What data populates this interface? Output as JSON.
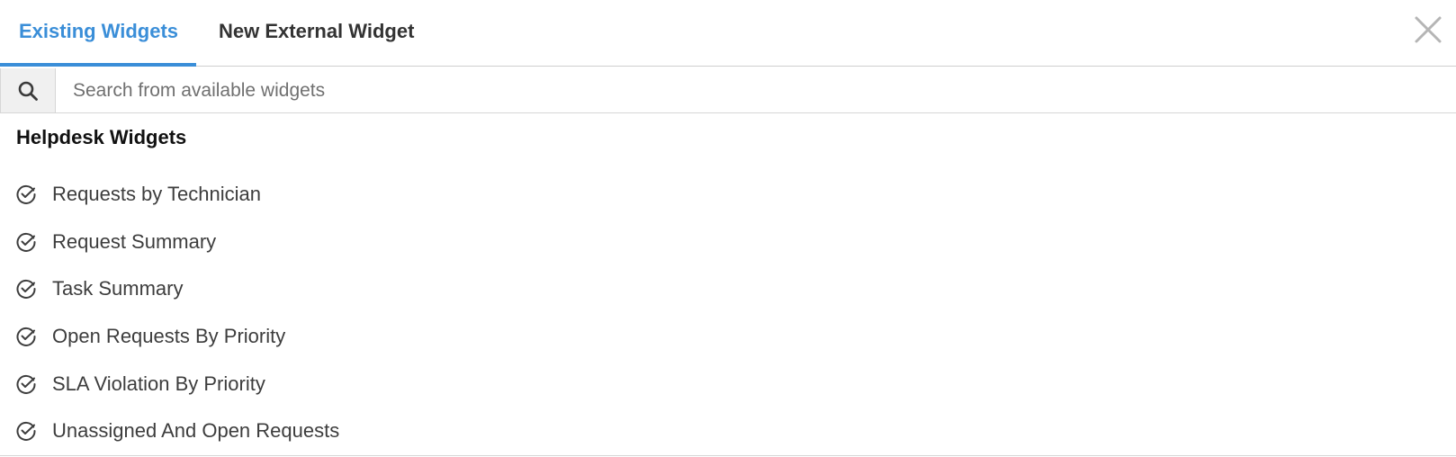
{
  "tabs": {
    "existing_label": "Existing Widgets",
    "external_label": "New External Widget"
  },
  "search": {
    "value": "",
    "placeholder": "Search from available widgets"
  },
  "section": {
    "title": "Helpdesk Widgets"
  },
  "widgets": [
    {
      "label": "Requests by Technician",
      "icon": "check-circle-icon"
    },
    {
      "label": "Request Summary",
      "icon": "check-circle-icon"
    },
    {
      "label": "Task Summary",
      "icon": "check-circle-icon"
    },
    {
      "label": "Open Requests By Priority",
      "icon": "check-circle-icon"
    },
    {
      "label": "SLA Violation By Priority",
      "icon": "check-circle-icon"
    },
    {
      "label": "Unassigned And Open Requests",
      "icon": "check-circle-icon"
    }
  ],
  "colors": {
    "accent": "#3a8ed8",
    "text": "#3d3d3d",
    "heading": "#111111",
    "border": "#d6d6d6"
  }
}
